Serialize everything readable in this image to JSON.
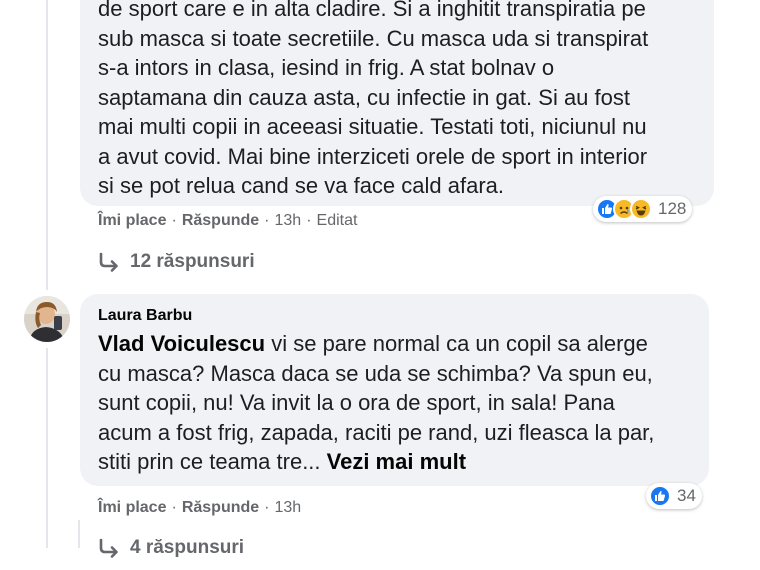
{
  "comment1": {
    "lines": [
      "de sport care e in alta cladire. Si a inghitit transpiratia pe",
      "sub masca si toate secretiile. Cu masca uda si transpirat",
      "s-a intors in clasa, iesind in frig. A stat bolnav o",
      "saptamana din cauza asta, cu infectie in gat. Si au fost",
      "mai multi copii in aceeasi situatie. Testati toti, niciunul nu",
      "a avut covid. Mai bine interziceti orele de sport in interior",
      "si se pot relua cand se va face cald afara."
    ],
    "like_label": "Îmi place",
    "reply_label": "Răspunde",
    "time": "13h",
    "edited_label": "Editat",
    "reaction_icons": [
      "like-icon",
      "sad-icon",
      "haha-icon"
    ],
    "reaction_count": "128",
    "replies_label": "12 răspunsuri"
  },
  "comment2": {
    "author": "Laura Barbu",
    "mention": "Vlad Voiculescu",
    "text_lines": [
      " vi se pare normal ca un copil sa alerge",
      "cu masca? Masca daca se uda se schimba? Va spun eu,",
      "sunt copii, nu! Va invit la o ora de sport, in sala! Pana",
      "acum a fost frig, zapada, raciti pe rand, uzi fleasca la par,",
      "stiti prin ce teama tre... "
    ],
    "see_more": "Vezi mai mult",
    "like_label": "Îmi place",
    "reply_label": "Răspunde",
    "time": "13h",
    "reaction_icons": [
      "like-icon"
    ],
    "reaction_count": "34",
    "replies_label": "4 răspunsuri"
  },
  "colors": {
    "bubble": "#f0f2f5",
    "meta_text": "#65676b",
    "like_blue": "#1877f2",
    "reaction_yellow": "#f7b928"
  }
}
